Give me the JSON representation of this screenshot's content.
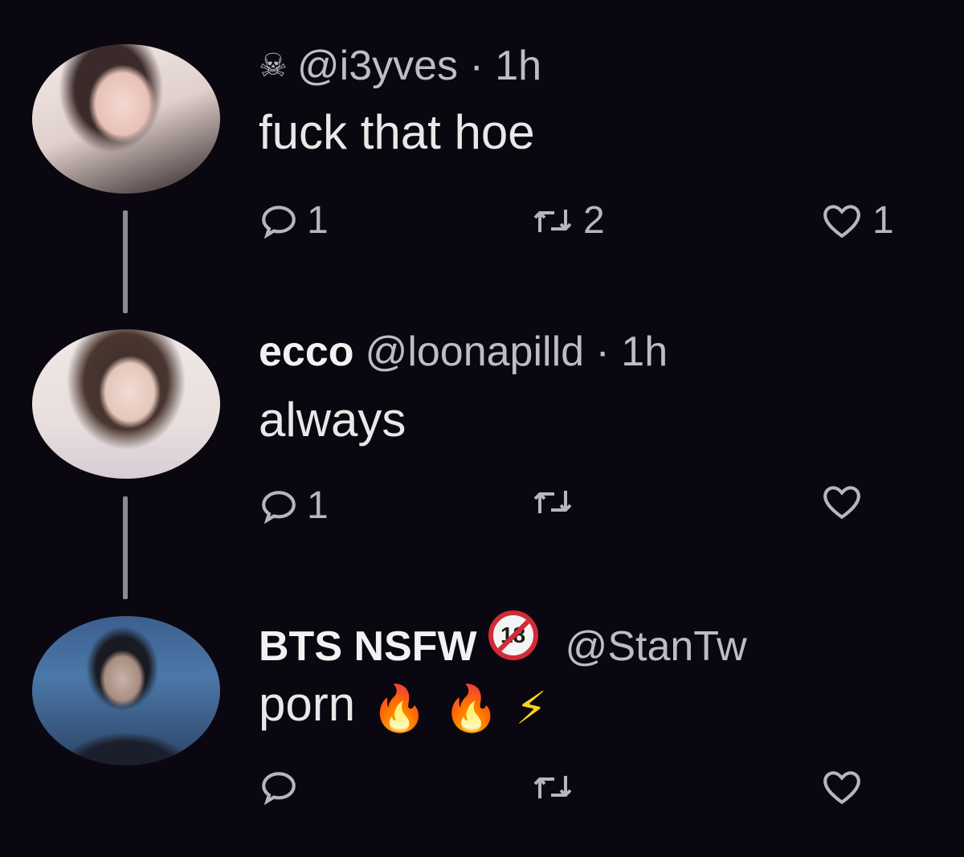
{
  "tweets": [
    {
      "display_name": "",
      "handle": "@i3yves",
      "time": "1h",
      "text": "fuck that hoe",
      "replies": "1",
      "retweets": "2",
      "likes": "1"
    },
    {
      "display_name": "ecco",
      "handle": "@loonapilld",
      "time": "1h",
      "text": "always",
      "replies": "1",
      "retweets": "",
      "likes": ""
    },
    {
      "display_name": "BTS NSFW",
      "badge": "18",
      "handle": "@StanTw",
      "time": "",
      "text": "porn",
      "replies": "",
      "retweets": "",
      "likes": ""
    }
  ],
  "icons": {
    "skull": "☠",
    "fire": "🔥",
    "bolt": "⚡"
  },
  "colors": {
    "background": "#0b0710",
    "text": "#e8e8e8",
    "muted": "#b6b6bc",
    "badge_red": "#d12b3a"
  }
}
